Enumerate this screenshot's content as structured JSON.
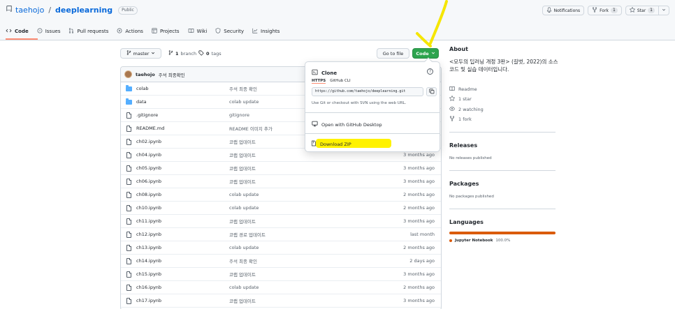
{
  "repo": {
    "owner": "taehojo",
    "separator": "/",
    "name": "deeplearning",
    "visibility": "Public"
  },
  "top_actions": {
    "notifications_label": "Notifications",
    "fork_label": "Fork",
    "fork_count": "1",
    "star_label": "Star",
    "star_count": "1"
  },
  "tabs": [
    {
      "label": "Code",
      "icon": "code-icon"
    },
    {
      "label": "Issues",
      "icon": "issue-icon"
    },
    {
      "label": "Pull requests",
      "icon": "pull-request-icon"
    },
    {
      "label": "Actions",
      "icon": "play-icon"
    },
    {
      "label": "Projects",
      "icon": "table-icon"
    },
    {
      "label": "Wiki",
      "icon": "book-icon"
    },
    {
      "label": "Security",
      "icon": "shield-icon"
    },
    {
      "label": "Insights",
      "icon": "graph-icon"
    }
  ],
  "branch_bar": {
    "branch": "master",
    "branch_count": "1",
    "branch_word": "branch",
    "tag_count": "0",
    "tag_word": "tags",
    "go_to_file": "Go to file",
    "code_button": "Code"
  },
  "commit": {
    "user": "taehojo",
    "message": "주석 최종확인"
  },
  "files": [
    {
      "type": "folder",
      "name": "colab",
      "message": "주석 최종 확인",
      "date": ""
    },
    {
      "type": "folder",
      "name": "data",
      "message": "colab update",
      "date": ""
    },
    {
      "type": "file",
      "name": ".gitignore",
      "message": "gitignore",
      "date": ""
    },
    {
      "type": "file",
      "name": "README.md",
      "message": "README 이미지 추가",
      "date": ""
    },
    {
      "type": "file",
      "name": "ch02.ipynb",
      "message": "코랩 업데이트",
      "date": ""
    },
    {
      "type": "file",
      "name": "ch04.ipynb",
      "message": "코랩 업데이트",
      "date": "3 months ago"
    },
    {
      "type": "file",
      "name": "ch05.ipynb",
      "message": "코랩 업데이트",
      "date": "3 months ago"
    },
    {
      "type": "file",
      "name": "ch06.ipynb",
      "message": "코랩 업데이트",
      "date": "3 months ago"
    },
    {
      "type": "file",
      "name": "ch08.ipynb",
      "message": "colab update",
      "date": "2 months ago"
    },
    {
      "type": "file",
      "name": "ch10.ipynb",
      "message": "colab update",
      "date": "2 months ago"
    },
    {
      "type": "file",
      "name": "ch11.ipynb",
      "message": "코랩 업데이트",
      "date": "3 months ago"
    },
    {
      "type": "file",
      "name": "ch12.ipynb",
      "message": "코랩 경로 업데이트",
      "date": "last month"
    },
    {
      "type": "file",
      "name": "ch13.ipynb",
      "message": "colab update",
      "date": "2 months ago"
    },
    {
      "type": "file",
      "name": "ch14.ipynb",
      "message": "주석 최종 확인",
      "date": "2 days ago"
    },
    {
      "type": "file",
      "name": "ch15.ipynb",
      "message": "코랩 업데이트",
      "date": "3 months ago"
    },
    {
      "type": "file",
      "name": "ch16.ipynb",
      "message": "colab update",
      "date": "2 months ago"
    },
    {
      "type": "file",
      "name": "ch17.ipynb",
      "message": "코랩 업데이트",
      "date": "3 months ago"
    }
  ],
  "clone_dropdown": {
    "title": "Clone",
    "tab_https": "HTTPS",
    "tab_cli": "GitHub CLI",
    "url": "https://github.com/taehojo/deeplearning.git",
    "note": "Use Git or checkout with SVN using the web URL.",
    "open_desktop": "Open with GitHub Desktop",
    "download_zip": "Download ZIP"
  },
  "sidebar": {
    "about_title": "About",
    "description": "<모두의 딥러닝 개정 3판> (길벗, 2022)의 소스코드 및 실습 데이터입니다.",
    "readme": "Readme",
    "stars": "1 star",
    "watching": "2 watching",
    "forks": "1 fork",
    "releases_title": "Releases",
    "releases_note": "No releases published",
    "packages_title": "Packages",
    "packages_note": "No packages published",
    "languages_title": "Languages",
    "language_name": "Jupyter Notebook",
    "language_percent": "100.0%"
  },
  "colors": {
    "code_button": "#2da44e",
    "link": "#0969da",
    "highlight": "#fff200",
    "language": "#da5b0b"
  }
}
